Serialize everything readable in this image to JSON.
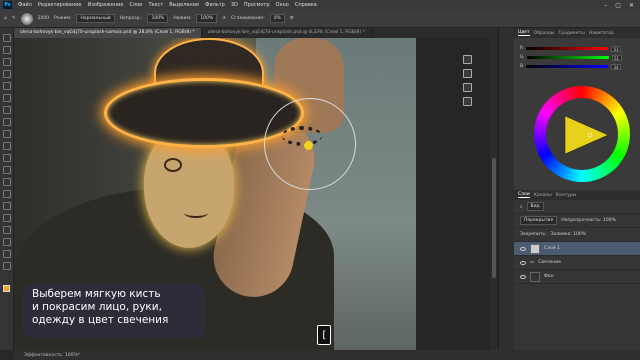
{
  "menu": [
    "Файл",
    "Редактирование",
    "Изображение",
    "Слои",
    "Текст",
    "Выделение",
    "Фильтр",
    "3D",
    "Просмотр",
    "Окно",
    "Справка"
  ],
  "options": {
    "mode_label": "Режим:",
    "mode_value": "Нормальный",
    "opacity_label": "Непрозр.:",
    "opacity_value": "100%",
    "flow_label": "Нажим:",
    "flow_value": "100%",
    "smoothing_label": "Сглаживание:",
    "smoothing_value": "0%",
    "brush_size": "2000"
  },
  "tabs": [
    {
      "label": "olena-bohovyk-bie_vqG4j70-unsplash-samois.psd @ 28,8% (Слой 1, RGB/8) *",
      "active": true
    },
    {
      "label": "olena-bohovyk-bie_vqG4j70-unsplash.psd @ 8,33% (Слой 1, RGB/8) *",
      "active": false
    }
  ],
  "caption": {
    "line1": "Выберем мягкую кисть",
    "line2": "и покрасим лицо, руки,",
    "line3": "одежду в цвет свечения"
  },
  "key_hint": "[",
  "status": {
    "zoom_text": "Эффективность: 100%*"
  },
  "panel": {
    "tabs": [
      "Цвет",
      "Образцы",
      "Градиенты",
      "Навигатор"
    ],
    "sliders": [
      {
        "label": "R",
        "value": "51"
      },
      {
        "label": "G",
        "value": "51"
      },
      {
        "label": "B",
        "value": "34"
      }
    ],
    "layers_tabs": [
      "Слои",
      "Каналы",
      "Контуры"
    ],
    "layer_filter": "Вид",
    "blend_mode": "Перекрытие",
    "opacity_label": "Непрозрачность: 100%",
    "lock_label": "Закрепить:",
    "fill_label": "Заливка: 100%",
    "layers": [
      {
        "name": "Слой 1",
        "selected": true
      },
      {
        "name": "Свечение",
        "selected": false
      },
      {
        "name": "Фон",
        "selected": false
      }
    ]
  }
}
